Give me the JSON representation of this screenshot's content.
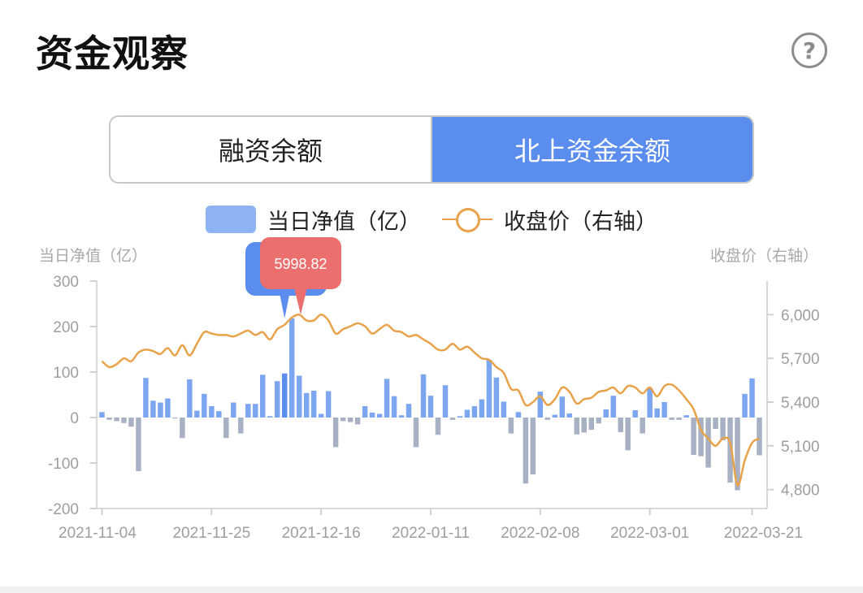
{
  "header": {
    "title": "资金观察",
    "help_icon": "help-circle-icon"
  },
  "tabs": [
    {
      "label": "融资余额",
      "active": false
    },
    {
      "label": "北上资金余额",
      "active": true
    }
  ],
  "legend": {
    "bar_label": "当日净值（亿）",
    "line_label": "收盘价（右轴）"
  },
  "colors": {
    "bar_positive": "#6f9cf0",
    "bar_negative": "#9fa9bd",
    "bar_highlight": "#5b8def",
    "line": "#e8a24a",
    "tooltip": "#ec6f6f",
    "active_tab": "#5b8def"
  },
  "tooltip": {
    "value": "5998.82"
  },
  "chart_data": {
    "type": "bar+line",
    "y_left_label": "当日净值（亿）",
    "y_right_label": "收盘价（右轴）",
    "y_left_ticks": [
      "300",
      "200",
      "100",
      "0",
      "-100",
      "-200"
    ],
    "y_left_ticks_values": [
      300,
      200,
      100,
      0,
      -100,
      -200
    ],
    "y_left_range": [
      -200,
      300
    ],
    "y_right_ticks": [
      "6,000",
      "5,700",
      "5,400",
      "5,100",
      "4,800"
    ],
    "y_right_ticks_values": [
      6000,
      5700,
      5400,
      5100,
      4800
    ],
    "y_right_range": [
      4670,
      6230
    ],
    "x_tick_labels": [
      "2021-11-04",
      "2021-11-25",
      "2021-12-16",
      "2022-01-11",
      "2022-02-08",
      "2022-03-01",
      "2022-03-21"
    ],
    "x_tick_indices": [
      0,
      15,
      30,
      45,
      60,
      75,
      89
    ],
    "highlight_index": 25,
    "bar_values": [
      12,
      -5,
      -8,
      -12,
      -20,
      -118,
      87,
      37,
      33,
      42,
      -2,
      -45,
      84,
      15,
      52,
      25,
      14,
      -45,
      33,
      -35,
      30,
      30,
      94,
      3,
      80,
      97,
      218,
      92,
      54,
      59,
      8,
      58,
      -65,
      -8,
      -10,
      -15,
      25,
      11,
      8,
      85,
      47,
      5,
      30,
      -65,
      95,
      48,
      -38,
      71,
      -5,
      3,
      17,
      25,
      40,
      127,
      88,
      35,
      -35,
      12,
      -145,
      -125,
      57,
      -5,
      6,
      46,
      9,
      -37,
      -33,
      -27,
      -13,
      18,
      48,
      -32,
      -72,
      16,
      -35,
      65,
      20,
      34,
      -5,
      -5,
      5,
      -82,
      -85,
      -110,
      -25,
      -50,
      -143,
      -160,
      52,
      86,
      -83
    ],
    "line_values": [
      5680,
      5640,
      5660,
      5700,
      5680,
      5740,
      5760,
      5750,
      5730,
      5770,
      5720,
      5790,
      5720,
      5800,
      5880,
      5870,
      5860,
      5860,
      5850,
      5870,
      5890,
      5860,
      5880,
      5830,
      5900,
      5930,
      5980,
      5999,
      5960,
      5960,
      6000,
      5960,
      5870,
      5900,
      5920,
      5940,
      5920,
      5870,
      5900,
      5930,
      5890,
      5880,
      5850,
      5860,
      5830,
      5800,
      5760,
      5760,
      5800,
      5760,
      5780,
      5740,
      5700,
      5690,
      5640,
      5600,
      5490,
      5480,
      5380,
      5400,
      5440,
      5380,
      5420,
      5500,
      5470,
      5390,
      5420,
      5430,
      5470,
      5480,
      5500,
      5460,
      5510,
      5500,
      5460,
      5500,
      5440,
      5510,
      5520,
      5480,
      5420,
      5350,
      5210,
      5150,
      5100,
      5150,
      5120,
      4830,
      5000,
      5120,
      5150
    ]
  }
}
